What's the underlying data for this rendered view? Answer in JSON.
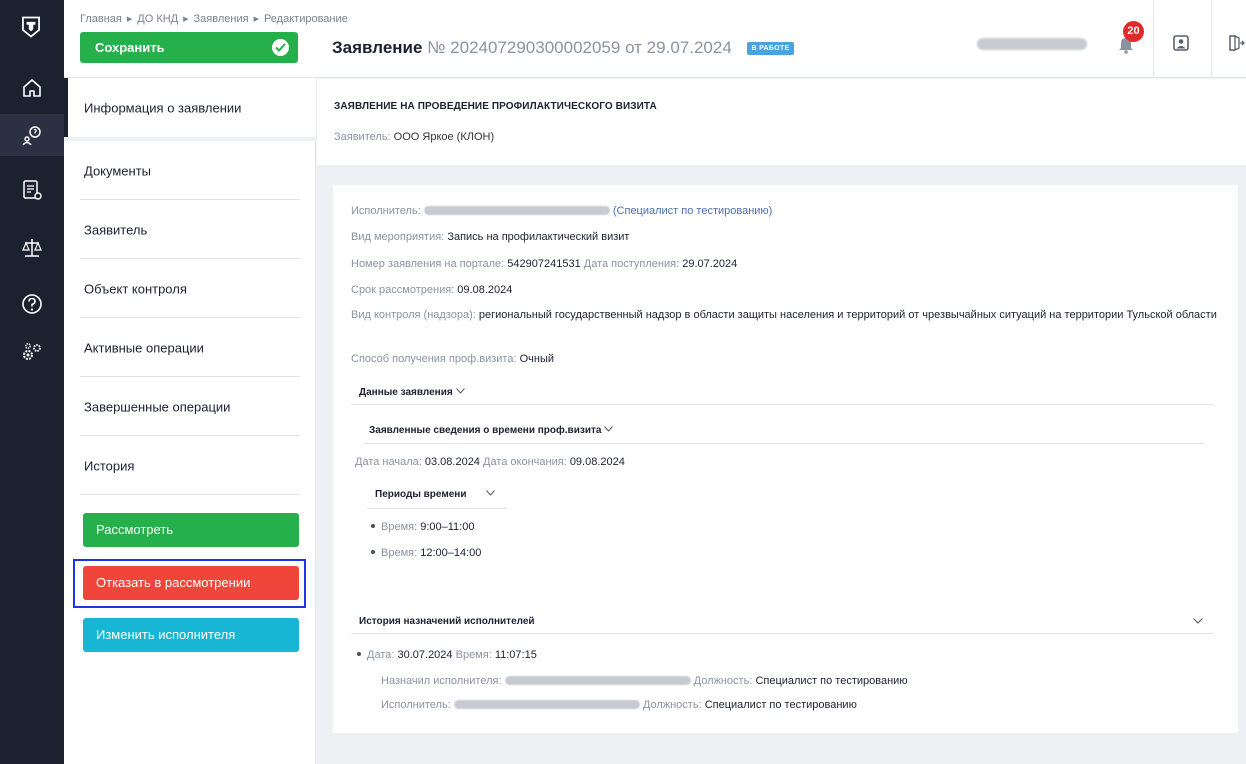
{
  "breadcrumb": {
    "items": [
      "Главная",
      "ДО КНД",
      "Заявления",
      "Редактирование"
    ]
  },
  "header": {
    "save_label": "Сохранить",
    "title_prefix": "Заявление",
    "title_number": "№ 202407290300002059",
    "title_date": "от 29.07.2024",
    "status": "В РАБОТЕ",
    "notifications_count": "20"
  },
  "menu": {
    "items": [
      {
        "label": "Информация о заявлении"
      },
      {
        "label": "Документы"
      },
      {
        "label": "Заявитель"
      },
      {
        "label": "Объект контроля"
      },
      {
        "label": "Активные операции"
      },
      {
        "label": "Завершенные операции"
      },
      {
        "label": "История"
      }
    ],
    "actions": {
      "review": "Рассмотреть",
      "reject": "Отказать в рассмотрении",
      "change_executor": "Изменить исполнителя"
    }
  },
  "application": {
    "heading": "ЗАЯВЛЕНИЕ НА ПРОВЕДЕНИЕ ПРОФИЛАКТИЧЕСКОГО ВИЗИТА",
    "applicant_label": "Заявитель:",
    "applicant_value": "ООО Яркое (КЛОН)"
  },
  "details": {
    "executor_label": "Исполнитель:",
    "executor_role": "(Специалист по тестированию)",
    "event_type_label": "Вид мероприятия:",
    "event_type_value": "Запись на профилактический визит",
    "portal_number_label": "Номер заявления на портале:",
    "portal_number_value": "542907241531",
    "received_label": "Дата поступления:",
    "received_value": "29.07.2024",
    "deadline_label": "Срок рассмотрения:",
    "deadline_value": "09.08.2024",
    "control_type_label": "Вид контроля (надзора):",
    "control_type_value": "региональный государственный надзор в области защиты населения и территорий от чрезвычайных ситуаций на территории Тульской области",
    "method_label": "Способ получения проф.визита:",
    "method_value": "Очный"
  },
  "application_data": {
    "section_title": "Данные заявления",
    "time_section_title": "Заявленные сведения о времени проф.визита",
    "start_label": "Дата начала:",
    "start_value": "03.08.2024",
    "end_label": "Дата окончания:",
    "end_value": "09.08.2024",
    "periods_title": "Периоды времени",
    "periods": [
      {
        "label": "Время:",
        "value": "9:00–11:00"
      },
      {
        "label": "Время:",
        "value": "12:00–14:00"
      }
    ]
  },
  "history": {
    "section_title": "История назначений исполнителей",
    "entry": {
      "date_label": "Дата:",
      "date_value": "30.07.2024",
      "time_label": "Время:",
      "time_value": "11:07:15",
      "assigned_by_label": "Назначил исполнителя:",
      "position_label_1": "Должность:",
      "position_value_1": "Специалист по тестированию",
      "executor_label": "Исполнитель:",
      "position_label_2": "Должность:",
      "position_value_2": "Специалист по тестированию"
    }
  },
  "colors": {
    "rail": "#1c2130",
    "green": "#25b04b",
    "red": "#f0453a",
    "cyan": "#16b6d4",
    "status_badge": "#4aa3df",
    "focus_frame": "#1d36e0"
  },
  "icons": {
    "rail": [
      "logo-shield-icon",
      "home-icon",
      "applications-icon",
      "registry-icon",
      "scales-icon",
      "help-icon",
      "settings-icon"
    ]
  }
}
